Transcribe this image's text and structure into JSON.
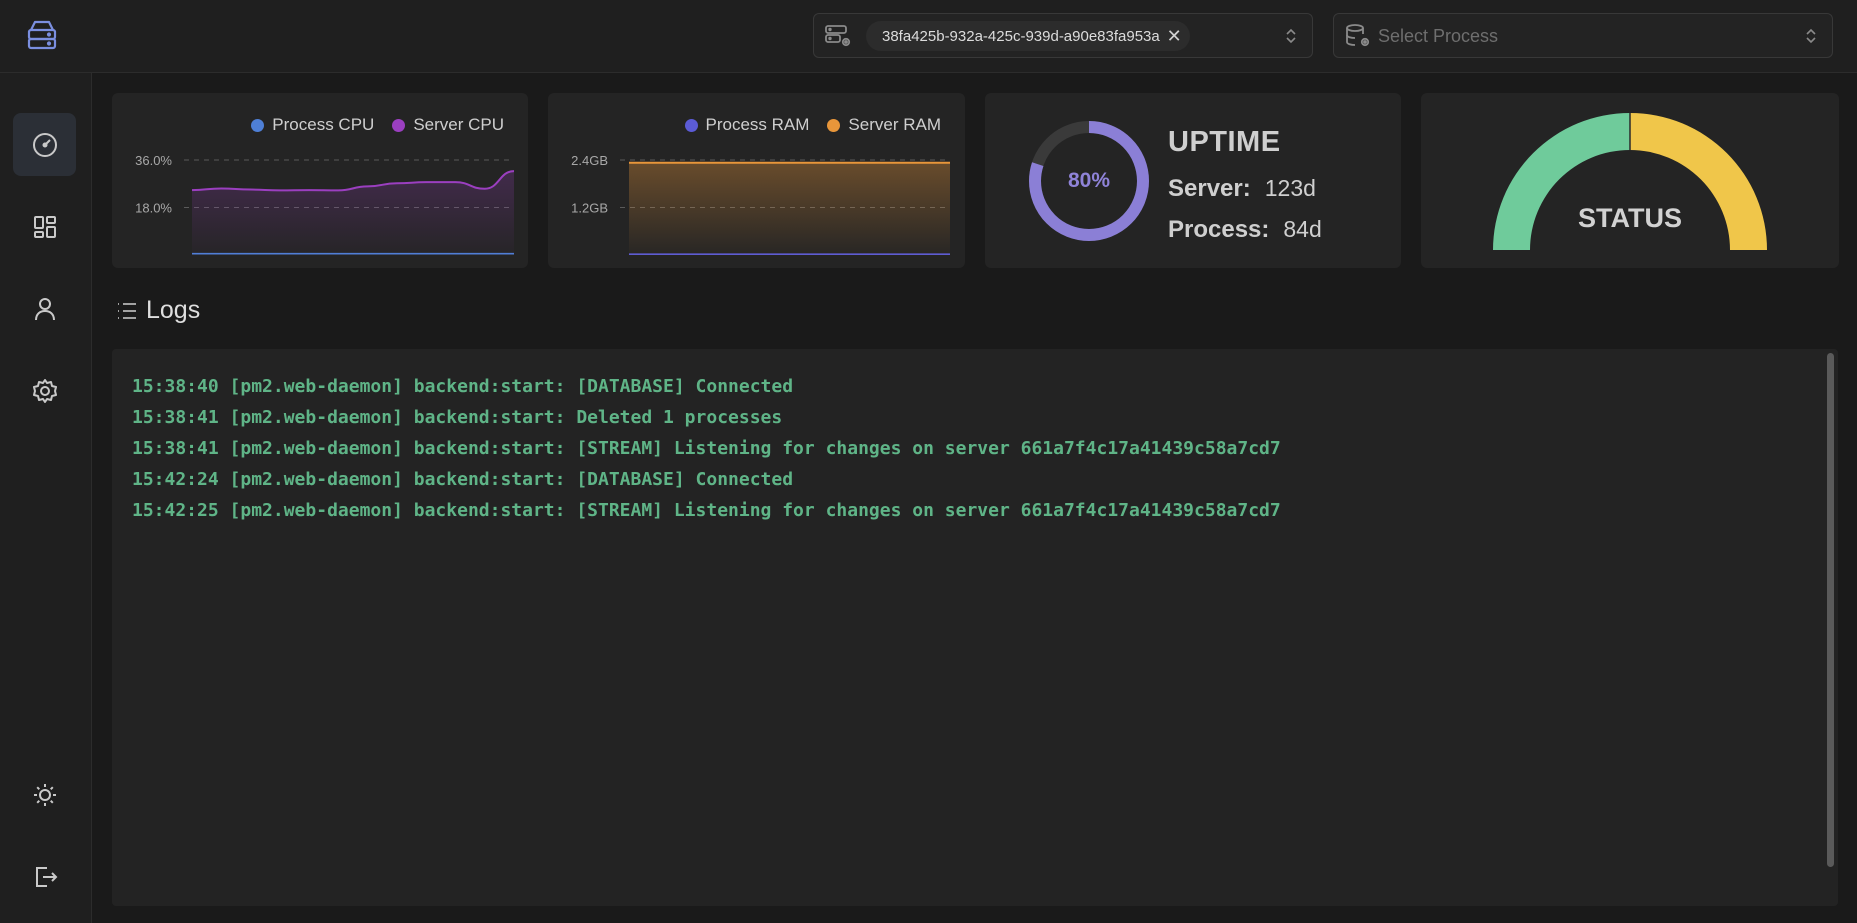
{
  "topbar": {
    "logo_icon": "server-stack-icon",
    "server_select": {
      "icon": "server-gear-icon",
      "selected": "38fa425b-932a-425c-939d-a90e83fa953a",
      "clear_glyph": "✕"
    },
    "process_select": {
      "icon": "database-gear-icon",
      "placeholder": "Select Process"
    }
  },
  "sidebar": {
    "items": [
      {
        "icon": "gauge-icon",
        "active": true
      },
      {
        "icon": "dashboard-grid-icon",
        "active": false
      },
      {
        "icon": "user-icon",
        "active": false
      },
      {
        "icon": "gear-icon",
        "active": false
      }
    ],
    "bottom": [
      {
        "icon": "sun-icon"
      },
      {
        "icon": "logout-icon"
      }
    ]
  },
  "cards": {
    "cpu": {
      "legend": [
        "Process CPU",
        "Server CPU"
      ],
      "colors": {
        "process": "#4e7fd6",
        "server": "#9b3fc0"
      }
    },
    "ram": {
      "legend": [
        "Process RAM",
        "Server RAM"
      ],
      "colors": {
        "process": "#5b5bd6",
        "server": "#e8963a"
      }
    },
    "uptime": {
      "percent_label": "80%",
      "percent": 80,
      "title": "UPTIME",
      "server_label": "Server:",
      "server_value": "123d",
      "process_label": "Process:",
      "process_value": "84d"
    },
    "status": {
      "label": "STATUS",
      "colors": {
        "left": "#6fcb9b",
        "right": "#f0c64a"
      }
    }
  },
  "chart_data": [
    {
      "type": "line",
      "yticks": [
        "36.0%",
        "18.0%"
      ],
      "ylim": [
        0,
        36
      ],
      "grid": true,
      "legend_position": "top-right",
      "series": [
        {
          "name": "Process CPU",
          "values": [
            0.5,
            0.5,
            0.5,
            0.5,
            0.5,
            0.5,
            0.5,
            0.5,
            0.5,
            0.5,
            0.5,
            0.5
          ]
        },
        {
          "name": "Server CPU",
          "values": [
            24.6,
            25.2,
            24.8,
            24.5,
            24.6,
            24.5,
            26.0,
            27.2,
            27.6,
            27.6,
            25.1,
            31.8
          ]
        }
      ]
    },
    {
      "type": "area",
      "yticks": [
        "2.4GB",
        "1.2GB"
      ],
      "ylim": [
        0,
        2.4
      ],
      "grid": true,
      "legend_position": "top-right",
      "series": [
        {
          "name": "Process RAM",
          "values": [
            0.02,
            0.02,
            0.02,
            0.02,
            0.02,
            0.02,
            0.02,
            0.02,
            0.02,
            0.02,
            0.02,
            0.02
          ]
        },
        {
          "name": "Server RAM",
          "values": [
            2.33,
            2.33,
            2.33,
            2.33,
            2.33,
            2.33,
            2.33,
            2.33,
            2.33,
            2.33,
            2.33,
            2.33
          ]
        }
      ]
    }
  ],
  "logs": {
    "title": "Logs",
    "icon": "list-icon",
    "lines": [
      "15:38:40 [pm2.web-daemon] backend:start: [DATABASE] Connected",
      "15:38:41 [pm2.web-daemon] backend:start: Deleted 1 processes",
      "15:38:41 [pm2.web-daemon] backend:start: [STREAM] Listening for changes on server 661a7f4c17a41439c58a7cd7",
      "15:42:24 [pm2.web-daemon] backend:start: [DATABASE] Connected",
      "15:42:25 [pm2.web-daemon] backend:start: [STREAM] Listening for changes on server 661a7f4c17a41439c58a7cd7"
    ]
  }
}
